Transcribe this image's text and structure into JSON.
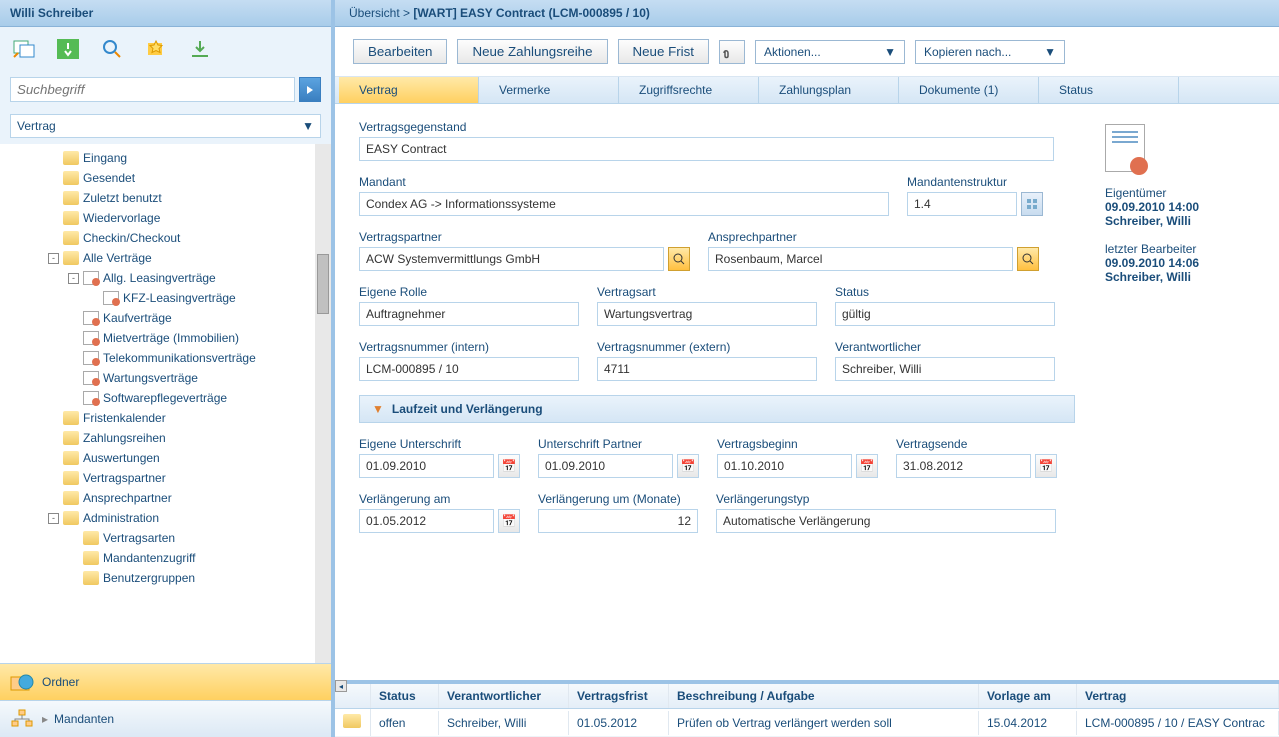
{
  "sidebar": {
    "title": "Willi Schreiber",
    "search_placeholder": "Suchbegriff",
    "dropdown": "Vertrag",
    "tree": [
      {
        "label": "Eingang",
        "icon": "inbox",
        "lvl": 1
      },
      {
        "label": "Gesendet",
        "icon": "folder",
        "lvl": 1
      },
      {
        "label": "Zuletzt benutzt",
        "icon": "recent",
        "lvl": 1
      },
      {
        "label": "Wiedervorlage",
        "icon": "resubmit",
        "lvl": 1
      },
      {
        "label": "Checkin/Checkout",
        "icon": "lock",
        "lvl": 1
      },
      {
        "label": "Alle Verträge",
        "icon": "folder-open",
        "lvl": 1,
        "exp": "-"
      },
      {
        "label": "Allg. Leasingverträge",
        "icon": "doc",
        "lvl": 2,
        "exp": "-"
      },
      {
        "label": "KFZ-Leasingverträge",
        "icon": "doc",
        "lvl": 3
      },
      {
        "label": "Kaufverträge",
        "icon": "doc",
        "lvl": 2
      },
      {
        "label": "Mietverträge (Immobilien)",
        "icon": "doc",
        "lvl": 2
      },
      {
        "label": "Telekommunikationsverträge",
        "icon": "doc",
        "lvl": 2
      },
      {
        "label": "Wartungsverträge",
        "icon": "doc",
        "lvl": 2
      },
      {
        "label": "Softwarepflegeverträge",
        "icon": "doc",
        "lvl": 2
      },
      {
        "label": "Fristenkalender",
        "icon": "calendar",
        "lvl": 1
      },
      {
        "label": "Zahlungsreihen",
        "icon": "payment",
        "lvl": 1
      },
      {
        "label": "Auswertungen",
        "icon": "chart",
        "lvl": 1
      },
      {
        "label": "Vertragspartner",
        "icon": "building",
        "lvl": 1
      },
      {
        "label": "Ansprechpartner",
        "icon": "person",
        "lvl": 1
      },
      {
        "label": "Administration",
        "icon": "folder-open",
        "lvl": 1,
        "exp": "-"
      },
      {
        "label": "Vertragsarten",
        "icon": "types",
        "lvl": 2
      },
      {
        "label": "Mandantenzugriff",
        "icon": "access",
        "lvl": 2
      },
      {
        "label": "Benutzergruppen",
        "icon": "groups",
        "lvl": 2
      }
    ],
    "panels": [
      {
        "label": "Ordner",
        "active": true
      },
      {
        "label": "Mandanten",
        "active": false
      }
    ]
  },
  "breadcrumb": {
    "root": "Übersicht",
    "sep": ">",
    "current": "[WART] EASY Contract (LCM-000895 / 10)"
  },
  "actions": {
    "edit": "Bearbeiten",
    "new_payment": "Neue Zahlungsreihe",
    "new_deadline": "Neue Frist",
    "menu": "Aktionen...",
    "copy": "Kopieren nach..."
  },
  "tabs": [
    "Vertrag",
    "Vermerke",
    "Zugriffsrechte",
    "Zahlungsplan",
    "Dokumente (1)",
    "Status"
  ],
  "form": {
    "subject_label": "Vertragsgegenstand",
    "subject": "EASY Contract",
    "client_label": "Mandant",
    "client": "Condex AG -> Informationssysteme",
    "client_struct_label": "Mandantenstruktur",
    "client_struct": "1.4",
    "partner_label": "Vertragspartner",
    "partner": "ACW Systemvermittlungs GmbH",
    "contact_label": "Ansprechpartner",
    "contact": "Rosenbaum, Marcel",
    "role_label": "Eigene Rolle",
    "role": "Auftragnehmer",
    "type_label": "Vertragsart",
    "type": "Wartungsvertrag",
    "status_label": "Status",
    "status": "gültig",
    "num_int_label": "Vertragsnummer (intern)",
    "num_int": "LCM-000895 / 10",
    "num_ext_label": "Vertragsnummer (extern)",
    "num_ext": "4711",
    "responsible_label": "Verantwortlicher",
    "responsible": "Schreiber, Willi",
    "section1": "Laufzeit und Verlängerung",
    "sign_own_label": "Eigene Unterschrift",
    "sign_own": "01.09.2010",
    "sign_partner_label": "Unterschrift Partner",
    "sign_partner": "01.09.2010",
    "start_label": "Vertragsbeginn",
    "start": "01.10.2010",
    "end_label": "Vertragsende",
    "end": "31.08.2012",
    "ext_on_label": "Verlängerung am",
    "ext_on": "01.05.2012",
    "ext_by_label": "Verlängerung um (Monate)",
    "ext_by": "12",
    "ext_type_label": "Verlängerungstyp",
    "ext_type": "Automatische Verlängerung"
  },
  "meta": {
    "owner_label": "Eigentümer",
    "owner_date": "09.09.2010 14:00",
    "owner_name": "Schreiber, Willi",
    "editor_label": "letzter Bearbeiter",
    "editor_date": "09.09.2010 14:06",
    "editor_name": "Schreiber, Willi"
  },
  "grid": {
    "headers": [
      "",
      "Status",
      "Verantwortlicher",
      "Vertragsfrist",
      "Beschreibung / Aufgabe",
      "Vorlage am",
      "Vertrag"
    ],
    "row": [
      "",
      "offen",
      "Schreiber, Willi",
      "01.05.2012",
      "Prüfen ob Vertrag verlängert werden soll",
      "15.04.2012",
      "LCM-000895 / 10 / EASY Contrac"
    ]
  }
}
